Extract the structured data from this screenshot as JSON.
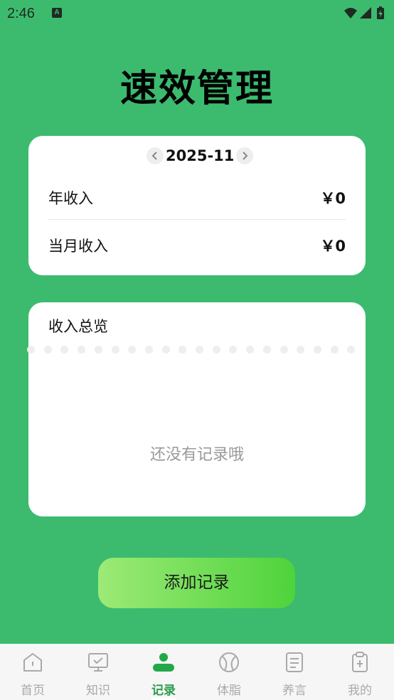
{
  "status_bar": {
    "time": "2:46",
    "notification_badge": "A"
  },
  "header": {
    "title": "速效管理"
  },
  "summary_card": {
    "month": "2025-11",
    "prev_icon": "chevron-left-icon",
    "next_icon": "chevron-right-icon",
    "rows": [
      {
        "label": "年收入",
        "value": "￥0"
      },
      {
        "label": "当月收入",
        "value": "￥0"
      }
    ]
  },
  "overview_card": {
    "title": "收入总览",
    "empty_text": "还没有记录哦"
  },
  "add_button": {
    "label": "添加记录"
  },
  "bottom_nav": {
    "tabs": [
      {
        "label": "首页",
        "icon": "home-icon",
        "active": false
      },
      {
        "label": "知识",
        "icon": "monitor-icon",
        "active": false
      },
      {
        "label": "记录",
        "icon": "person-icon",
        "active": true
      },
      {
        "label": "体脂",
        "icon": "ball-icon",
        "active": false
      },
      {
        "label": "养言",
        "icon": "document-icon",
        "active": false
      },
      {
        "label": "我的",
        "icon": "clipboard-icon",
        "active": false
      }
    ]
  },
  "colors": {
    "background": "#3cbb6f",
    "accent": "#2e9c4f",
    "button_start": "#9cea76",
    "button_end": "#4ed33c"
  }
}
